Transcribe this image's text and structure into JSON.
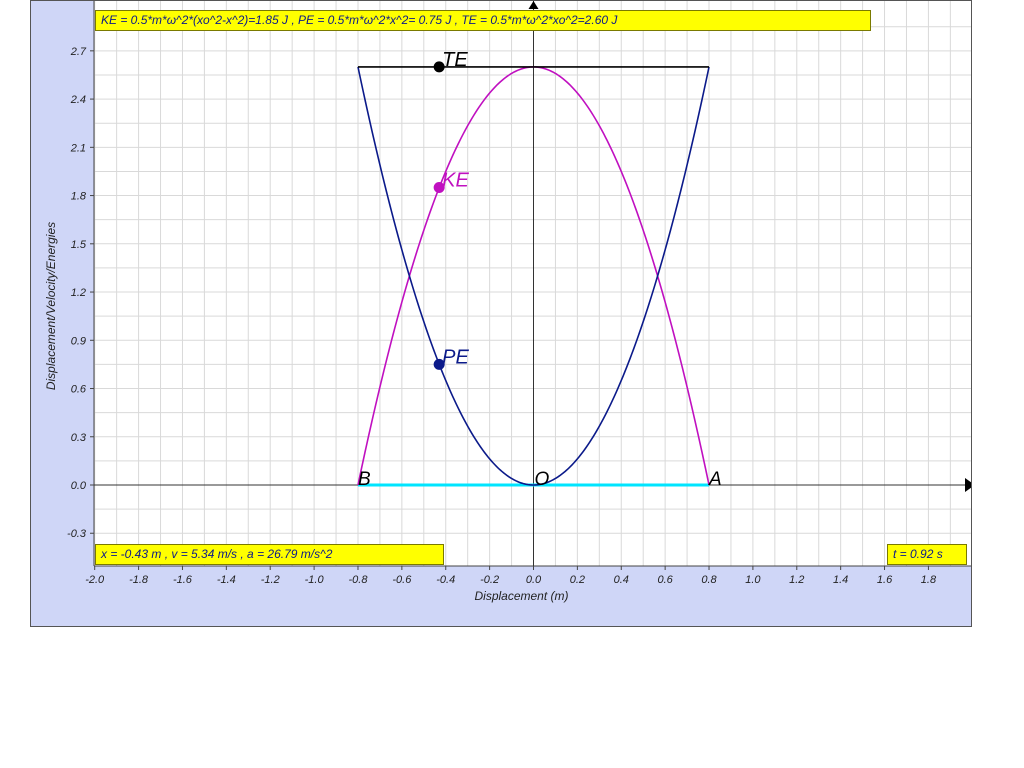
{
  "readouts": {
    "energies": "KE = 0.5*m*ω^2*(xo^2-x^2)=1.85 J , PE = 0.5*m*ω^2*x^2= 0.75 J , TE = 0.5*m*ω^2*xo^2=2.60 J",
    "motion": "x = -0.43 m , v = 5.34 m/s , a = 26.79 m/s^2",
    "time": "t = 0.92 s"
  },
  "colors": {
    "background": "#ffffff",
    "panel": "#cfd6f7",
    "readout": "#ffff00",
    "ke": "#c010c0",
    "pe": "#0b1a8a",
    "te": "#000000",
    "path": "#00e5ff",
    "grid": "#d9d9d9"
  },
  "chart_data": {
    "type": "line",
    "xlabel": "Displacement (m)",
    "ylabel": "Displacement/Velocity/Energies",
    "xlim": [
      -2.1,
      2.0
    ],
    "ylim": [
      -0.3,
      2.8
    ],
    "x_ticks": [
      "-2.0",
      "-1.8",
      "-1.6",
      "-1.4",
      "-1.2",
      "-1.0",
      "-0.8",
      "-0.6",
      "-0.4",
      "-0.2",
      "0.0",
      "0.2",
      "0.4",
      "0.6",
      "0.8",
      "1.0",
      "1.2",
      "1.4",
      "1.6",
      "1.8"
    ],
    "y_ticks": [
      "-0.3",
      "0.0",
      "0.3",
      "0.6",
      "0.9",
      "1.2",
      "1.5",
      "1.8",
      "2.1",
      "2.4",
      "2.7"
    ],
    "amplitude": 0.8,
    "total_energy": 2.6,
    "series": [
      {
        "name": "KE",
        "color": "#c010c0",
        "x": [
          -0.8,
          -0.6,
          -0.4,
          -0.2,
          0.0,
          0.2,
          0.4,
          0.6,
          0.8
        ],
        "y": [
          0.0,
          1.1375,
          1.95,
          2.4375,
          2.6,
          2.4375,
          1.95,
          1.1375,
          0.0
        ]
      },
      {
        "name": "PE",
        "color": "#0b1a8a",
        "x": [
          -0.8,
          -0.6,
          -0.4,
          -0.2,
          0.0,
          0.2,
          0.4,
          0.6,
          0.8
        ],
        "y": [
          2.6,
          1.4625,
          0.65,
          0.1625,
          0.0,
          0.1625,
          0.65,
          1.4625,
          2.6
        ]
      },
      {
        "name": "TE",
        "color": "#000000",
        "x": [
          -0.8,
          0.8
        ],
        "y": [
          2.6,
          2.6
        ]
      }
    ],
    "markers": [
      {
        "label": "TE",
        "x": -0.43,
        "y": 2.6,
        "color": "#000000"
      },
      {
        "label": "KE",
        "x": -0.43,
        "y": 1.85,
        "color": "#c010c0"
      },
      {
        "label": "PE",
        "x": -0.43,
        "y": 0.75,
        "color": "#0b1a8a"
      }
    ],
    "point_labels": [
      {
        "label": "B",
        "x": -0.8,
        "y": 0.0
      },
      {
        "label": "O",
        "x": 0.0,
        "y": 0.0
      },
      {
        "label": "A",
        "x": 0.8,
        "y": 0.0
      }
    ]
  }
}
